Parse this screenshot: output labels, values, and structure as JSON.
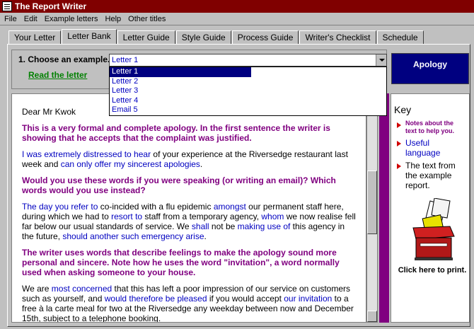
{
  "window": {
    "title": "The Report Writer"
  },
  "menu": [
    "File",
    "Edit",
    "Example letters",
    "Help",
    "Other titles"
  ],
  "tabs": [
    {
      "label": "Your Letter"
    },
    {
      "label": "Letter Bank"
    },
    {
      "label": "Letter Guide"
    },
    {
      "label": "Style Guide"
    },
    {
      "label": "Process Guide"
    },
    {
      "label": "Writer's Checklist"
    },
    {
      "label": "Schedule"
    }
  ],
  "chooser": {
    "label": "1. Choose an example.",
    "selected": "Letter 1",
    "read_link": "Read the letter",
    "options": [
      "Letter 1",
      "Letter 2",
      "Letter 3",
      "Letter 4",
      "Email 5"
    ]
  },
  "badge": "Apology",
  "letter": {
    "salutation": "Dear Mr Kwok",
    "note1": "This is a very formal and complete apology. In the first sentence the writer is showing that he accepts that the complaint was justified.",
    "p1": {
      "a": "I was extremely distressed to hear",
      "b": " of your experience at the Riversedge restaurant last week and ",
      "c": "can only offer my sincerest apologies",
      "d": "."
    },
    "note2": "Would you use these words if you were speaking (or writing an email)? Which words would you use instead?",
    "p2": {
      "a": "The day you refer to",
      "b": " co-incided with a flu epidemic ",
      "c": "amongst",
      "d": " our permanent staff here, during which we had to ",
      "e": "resort to",
      "f": " staff from a temporary agency, ",
      "g": "whom",
      "h": " we now realise fell far below our usual standards of service. We ",
      "i": "shall",
      "j": " not be ",
      "k": "making use of",
      "l": " this agency in the future, ",
      "m": "should another such emergency arise",
      "n": "."
    },
    "note3": "The writer uses words that describe feelings to make the apology sound more personal and sincere. Note how he uses the word \"invitation\", a word normally used when asking someone to your house.",
    "p3": {
      "a": "We are ",
      "b": "most concerned",
      "c": " that this has left a poor impression of our service on customers such as yourself, and ",
      "d": "would therefore be pleased",
      "e": " if you would accept ",
      "f": "our invitation",
      "g": " to a free à la carte meal for two at the Riversedge any weekday between now and December 15th, subject to a telephone booking."
    }
  },
  "key": {
    "title": "Key",
    "items": [
      "Notes about the text to help you.",
      "Useful language",
      "The text from the example report."
    ]
  },
  "print_label": "Click here to print.",
  "colors": {
    "note": "#800080",
    "useful": "#0000c0",
    "title_bar": "#800000",
    "badge": "#000080"
  }
}
